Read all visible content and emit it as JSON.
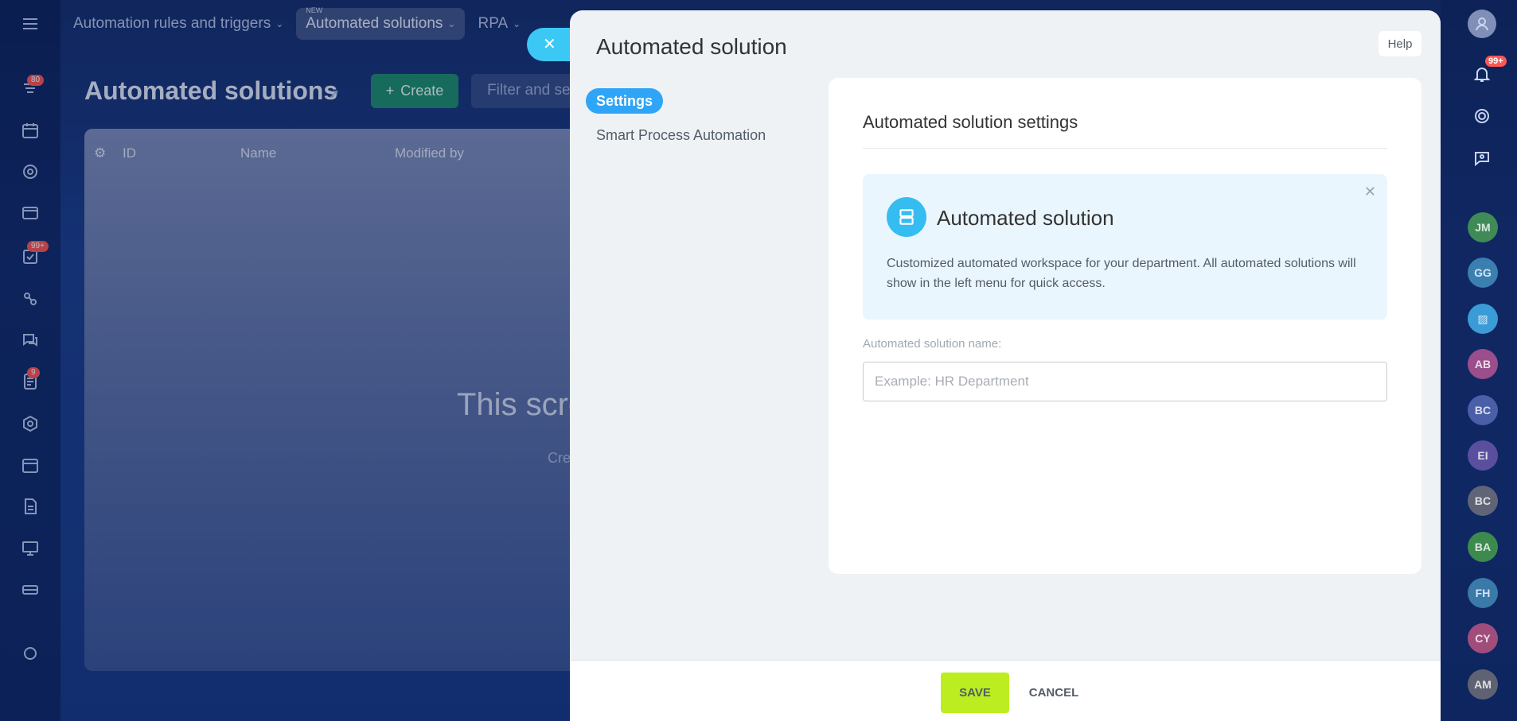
{
  "topbar": {
    "tabs": [
      {
        "label": "Automation rules and triggers"
      },
      {
        "label": "Automated solutions",
        "badge": "NEW"
      },
      {
        "label": "RPA"
      }
    ]
  },
  "page": {
    "title": "Automated solutions",
    "create_label": "Create",
    "filter_placeholder": "Filter and sea",
    "columns": [
      "ID",
      "Name",
      "Modified by"
    ],
    "empty_text": "This scre",
    "empty_sub": "Cre"
  },
  "left_rail": {
    "badges": {
      "feed": "80",
      "tasks": "99+",
      "docs": "9"
    }
  },
  "slider": {
    "title": "Automated solution",
    "help_label": "Help",
    "nav": {
      "settings": "Settings",
      "spa": "Smart Process Automation"
    },
    "card": {
      "heading": "Automated solution settings",
      "info_title": "Automated solution",
      "info_text": "Customized automated workspace for your department. All automated solutions will show in the left menu for quick access.",
      "field_label": "Automated solution name:",
      "field_placeholder": "Example: HR Department",
      "field_value": ""
    },
    "footer": {
      "save": "SAVE",
      "cancel": "CANCEL"
    }
  },
  "right_rail": {
    "bell_badge": "99+",
    "avatars": [
      {
        "initials": "JM",
        "color": "#3f8a56"
      },
      {
        "initials": "GG",
        "color": "#3a7fb0"
      },
      {
        "initials": "",
        "color": "#3b9bd6"
      },
      {
        "initials": "AB",
        "color": "#9a4e8c"
      },
      {
        "initials": "BC",
        "color": "#4b5fa8"
      },
      {
        "initials": "EI",
        "color": "#5a4e9e"
      },
      {
        "initials": "BC",
        "color": "#5f6577"
      },
      {
        "initials": "BA",
        "color": "#3d8a4e"
      },
      {
        "initials": "FH",
        "color": "#3b79a8"
      },
      {
        "initials": "CY",
        "color": "#a04d7c"
      },
      {
        "initials": "AM",
        "color": "#5e6272"
      }
    ]
  },
  "colors": {
    "accent": "#2fa5f7",
    "save": "#bbed21",
    "badge": "#ff5752"
  }
}
